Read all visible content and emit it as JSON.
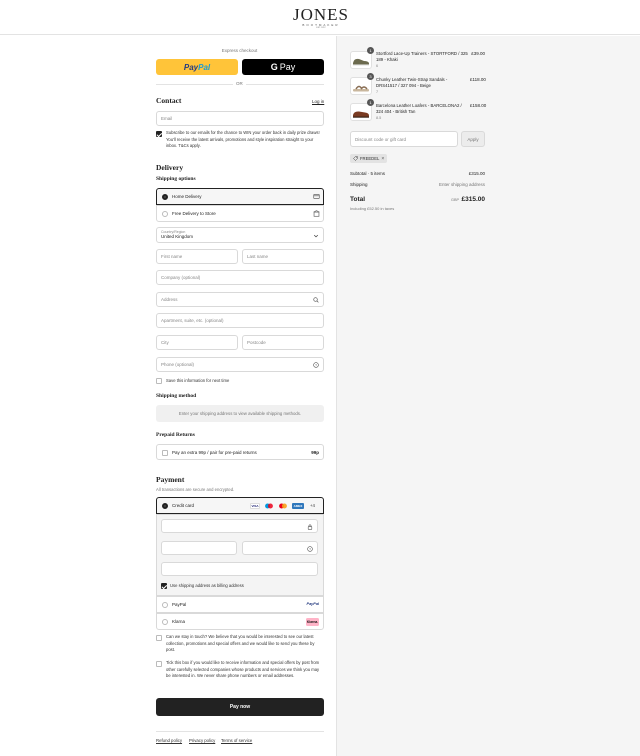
{
  "brand": {
    "name": "JONES",
    "sub": "BOOTMAKER",
    "tag": "EST. 1857"
  },
  "express": {
    "title": "Express checkout",
    "paypal_a": "Pay",
    "paypal_b": "Pal",
    "gpay_g": "G",
    "gpay_pay": "Pay",
    "or": "OR"
  },
  "contact": {
    "heading": "Contact",
    "login": "Log in",
    "email_placeholder": "Email",
    "subscribe_text": "Subscribe to our emails for the chance to WIN your order back in daily prize draws! You'll receive the latest arrivals, promotions and style inspiration straight to your inbox. T&Cs apply.",
    "subscribe_checked": true
  },
  "delivery": {
    "heading": "Delivery",
    "shipping_options_label": "Shipping options",
    "options": [
      {
        "label": "Home Delivery",
        "selected": true
      },
      {
        "label": "Free Delivery to Store",
        "selected": false
      }
    ],
    "country_label": "Country/Region",
    "country_value": "United Kingdom",
    "first_name": "First name",
    "last_name": "Last name",
    "company": "Company (optional)",
    "address": "Address",
    "apartment": "Apartment, suite, etc. (optional)",
    "city": "City",
    "postcode": "Postcode",
    "phone": "Phone (optional)",
    "save_info": "Save this information for next time"
  },
  "shipping_method": {
    "heading": "Shipping method",
    "empty_text": "Enter your shipping address to view available shipping methods."
  },
  "prepaid_returns": {
    "heading": "Prepaid Returns",
    "label": "Pay an extra 99p / pair for pre-paid returns",
    "price": "99p"
  },
  "payment": {
    "heading": "Payment",
    "subtext": "All transactions are secure and encrypted.",
    "credit_card": "Credit card",
    "card_brands": [
      "VISA",
      "MC",
      "MC",
      "AMEX"
    ],
    "more_cards": "+4",
    "billing_same": "Use shipping address as billing address",
    "paypal": "PayPal",
    "paypal_logo": "PayPal",
    "klarna": "Klarna",
    "klarna_logo": "Klarna."
  },
  "consent": {
    "stay_in_touch": "Can we stay in touch? We believe that you would be interested to see our latest collection, promotions and special offers and we would like to send you these by post.",
    "third_party": "Tick this box if you would like to receive information and special offers by post from other carefully selected companies whose products and services we think you may be interested in. We never share phone numbers or email addresses."
  },
  "pay_now": "Pay now",
  "footer": [
    "Refund policy",
    "Privacy policy",
    "Terms of service"
  ],
  "summary": {
    "items": [
      {
        "qty": "1",
        "name": "Stortford Lace-Up Trainers - STORTFORD / 325 189 - Khaki",
        "size": "6",
        "price": "£39.00"
      },
      {
        "qty": "3",
        "name": "Chunky Leather Twin-Strap Sandals - DRS41517 / 327 094 - Beige",
        "size": "7",
        "price": "£118.00"
      },
      {
        "qty": "1",
        "name": "Barcelona Leather Loafers - BARCELONA2 / 324 404 - British Tan",
        "size": "8.5",
        "price": "£158.00"
      }
    ],
    "discount_placeholder": "Discount code or gift card",
    "apply": "Apply",
    "discount_tag": "FREEDEL",
    "subtotal_label": "Subtotal · 5 items",
    "subtotal_value": "£315.00",
    "shipping_label": "Shipping",
    "shipping_value": "Enter shipping address",
    "total_label": "Total",
    "currency": "GBP",
    "total_value": "£315.00",
    "tax_note": "Including £52.50 in taxes"
  },
  "colors": {
    "primary": "#222222",
    "paypal_yellow": "#ffc439",
    "summary_bg": "#f5f5f5"
  }
}
